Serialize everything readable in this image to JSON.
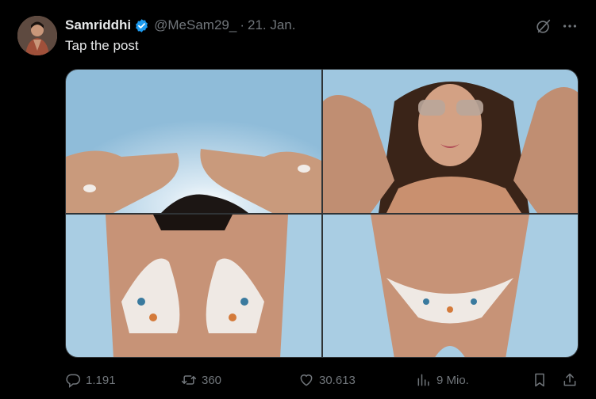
{
  "author": {
    "name": "Samriddhi",
    "handle": "@MeSam29_",
    "separator": "·",
    "date": "21. Jan.",
    "verified": true,
    "badge_color": "#1d9bf0"
  },
  "post": {
    "text": "Tap the post"
  },
  "media": {
    "images": [
      {
        "icon": "photo-hands-sky"
      },
      {
        "icon": "photo-woman-sunglasses"
      },
      {
        "icon": "photo-butterfly-bikini-top"
      },
      {
        "icon": "photo-butterfly-bikini-bottom"
      }
    ]
  },
  "actions": {
    "replies": "1.191",
    "reposts": "360",
    "likes": "30.613",
    "views": "9 Mio."
  },
  "colors": {
    "background": "#000000",
    "text": "#e7e9ea",
    "muted": "#71767b"
  }
}
